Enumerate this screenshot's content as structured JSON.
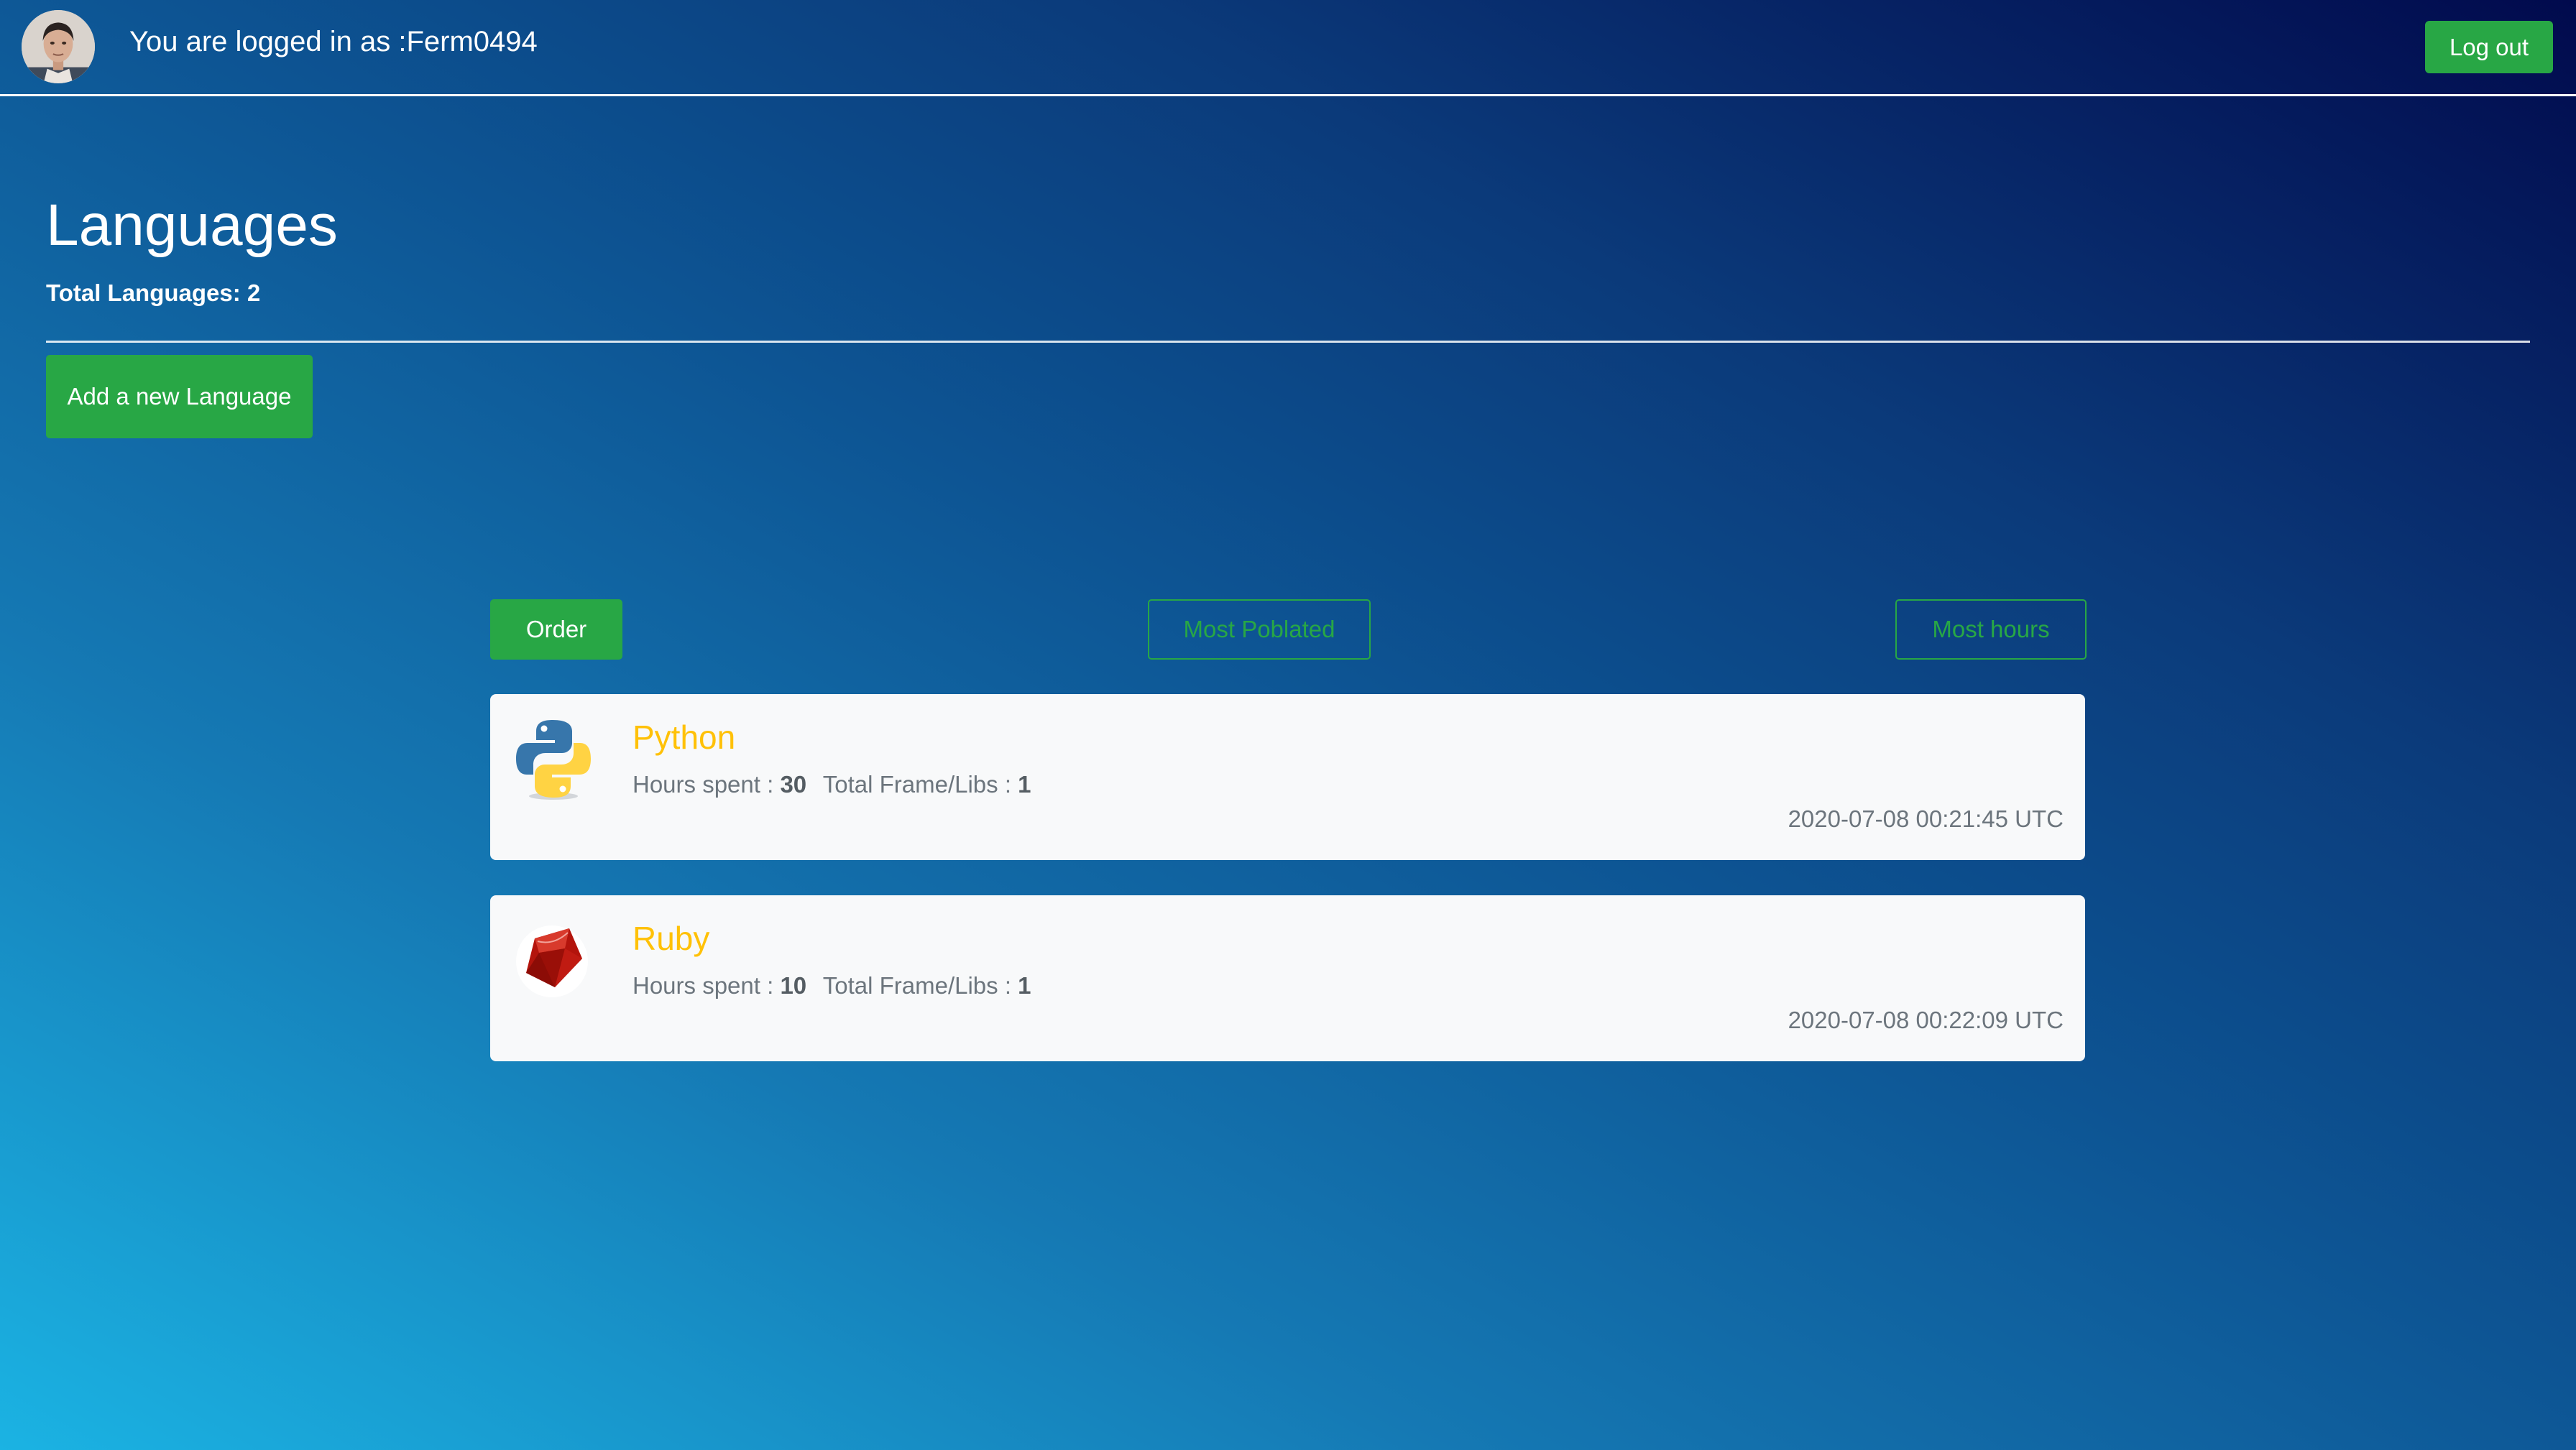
{
  "header": {
    "login_text": "You are logged in as :Ferm0494",
    "logout_label": "Log out"
  },
  "page": {
    "title": "Languages",
    "total_text": "Total Languages: 2",
    "add_button_label": "Add a new Language"
  },
  "sort_controls": {
    "order_label": "Order",
    "most_populated_label": "Most Poblated",
    "most_hours_label": "Most hours"
  },
  "languages": [
    {
      "name": "Python",
      "hours_label": "Hours spent :",
      "hours": "30",
      "libs_label": "Total Frame/Libs :",
      "libs": "1",
      "date": "2020-07-08 00:21:45 UTC",
      "icon": "python-logo-icon"
    },
    {
      "name": "Ruby",
      "hours_label": "Hours spent :",
      "hours": "10",
      "libs_label": "Total Frame/Libs :",
      "libs": "1",
      "date": "2020-07-08 00:22:09 UTC",
      "icon": "ruby-logo-icon"
    }
  ],
  "colors": {
    "success": "#28a745",
    "warning": "#ffc107",
    "card_bg": "#f8f9fa",
    "muted_text": "#6c757d",
    "gradient_light": "#1bb3e3",
    "gradient_dark": "#010a4d"
  }
}
